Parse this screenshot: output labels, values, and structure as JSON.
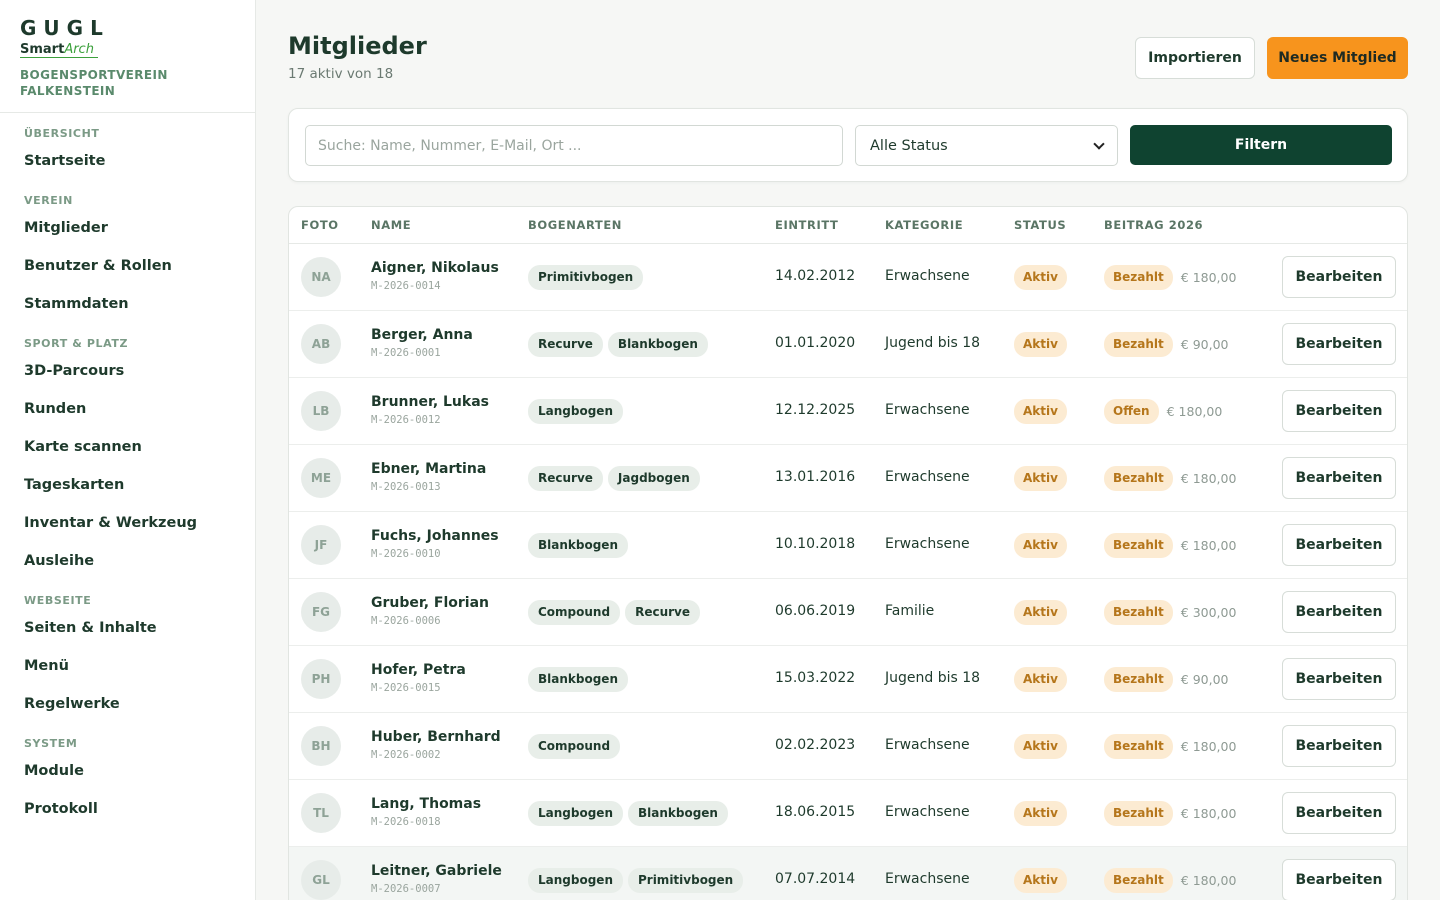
{
  "brand": {
    "logo_top": "GUGL",
    "logo_smart": "Smart",
    "logo_arch": "Arch",
    "club_line1": "BOGENSPORTVEREIN",
    "club_line2": "FALKENSTEIN"
  },
  "sidebar": {
    "sections": [
      {
        "title": "ÜBERSICHT",
        "items": [
          "Startseite"
        ]
      },
      {
        "title": "VEREIN",
        "items": [
          "Mitglieder",
          "Benutzer & Rollen",
          "Stammdaten"
        ]
      },
      {
        "title": "SPORT & PLATZ",
        "items": [
          "3D-Parcours",
          "Runden",
          "Karte scannen",
          "Tageskarten",
          "Inventar & Werkzeug",
          "Ausleihe"
        ]
      },
      {
        "title": "WEBSEITE",
        "items": [
          "Seiten & Inhalte",
          "Menü",
          "Regelwerke"
        ]
      },
      {
        "title": "SYSTEM",
        "items": [
          "Module",
          "Protokoll"
        ]
      }
    ]
  },
  "header": {
    "title": "Mitglieder",
    "subtitle": "17 aktiv von 18",
    "import_label": "Importieren",
    "new_label": "Neues Mitglied"
  },
  "filters": {
    "search_placeholder": "Suche: Name, Nummer, E-Mail, Ort ...",
    "status_value": "Alle Status",
    "filter_label": "Filtern"
  },
  "table": {
    "columns": [
      "FOTO",
      "NAME",
      "BOGENARTEN",
      "EINTRITT",
      "KATEGORIE",
      "STATUS",
      "BEITRAG 2026"
    ],
    "edit_label": "Bearbeiten",
    "rows": [
      {
        "initials": "NA",
        "name": "Aigner, Nikolaus",
        "number": "M-2026-0014",
        "bows": [
          "Primitivbogen"
        ],
        "joined": "14.02.2012",
        "category": "Erwachsene",
        "status": "Aktiv",
        "payment": "Bezahlt",
        "amount": "€ 180,00"
      },
      {
        "initials": "AB",
        "name": "Berger, Anna",
        "number": "M-2026-0001",
        "bows": [
          "Recurve",
          "Blankbogen"
        ],
        "joined": "01.01.2020",
        "category": "Jugend bis 18",
        "status": "Aktiv",
        "payment": "Bezahlt",
        "amount": "€ 90,00"
      },
      {
        "initials": "LB",
        "name": "Brunner, Lukas",
        "number": "M-2026-0012",
        "bows": [
          "Langbogen"
        ],
        "joined": "12.12.2025",
        "category": "Erwachsene",
        "status": "Aktiv",
        "payment": "Offen",
        "amount": "€ 180,00"
      },
      {
        "initials": "ME",
        "name": "Ebner, Martina",
        "number": "M-2026-0013",
        "bows": [
          "Recurve",
          "Jagdbogen"
        ],
        "joined": "13.01.2016",
        "category": "Erwachsene",
        "status": "Aktiv",
        "payment": "Bezahlt",
        "amount": "€ 180,00"
      },
      {
        "initials": "JF",
        "name": "Fuchs, Johannes",
        "number": "M-2026-0010",
        "bows": [
          "Blankbogen"
        ],
        "joined": "10.10.2018",
        "category": "Erwachsene",
        "status": "Aktiv",
        "payment": "Bezahlt",
        "amount": "€ 180,00"
      },
      {
        "initials": "FG",
        "name": "Gruber, Florian",
        "number": "M-2026-0006",
        "bows": [
          "Compound",
          "Recurve"
        ],
        "joined": "06.06.2019",
        "category": "Familie",
        "status": "Aktiv",
        "payment": "Bezahlt",
        "amount": "€ 300,00"
      },
      {
        "initials": "PH",
        "name": "Hofer, Petra",
        "number": "M-2026-0015",
        "bows": [
          "Blankbogen"
        ],
        "joined": "15.03.2022",
        "category": "Jugend bis 18",
        "status": "Aktiv",
        "payment": "Bezahlt",
        "amount": "€ 90,00"
      },
      {
        "initials": "BH",
        "name": "Huber, Bernhard",
        "number": "M-2026-0002",
        "bows": [
          "Compound"
        ],
        "joined": "02.02.2023",
        "category": "Erwachsene",
        "status": "Aktiv",
        "payment": "Bezahlt",
        "amount": "€ 180,00"
      },
      {
        "initials": "TL",
        "name": "Lang, Thomas",
        "number": "M-2026-0018",
        "bows": [
          "Langbogen",
          "Blankbogen"
        ],
        "joined": "18.06.2015",
        "category": "Erwachsene",
        "status": "Aktiv",
        "payment": "Bezahlt",
        "amount": "€ 180,00"
      },
      {
        "initials": "GL",
        "name": "Leitner, Gabriele",
        "number": "M-2026-0007",
        "bows": [
          "Langbogen",
          "Primitivbogen"
        ],
        "joined": "07.07.2014",
        "category": "Erwachsene",
        "status": "Aktiv",
        "payment": "Bezahlt",
        "amount": "€ 180,00"
      }
    ]
  },
  "colors": {
    "primary_dark": "#0f4330",
    "accent_orange": "#f7941d",
    "badge_bg": "#fcebd2",
    "badge_text": "#b5761b",
    "chip_bg": "#e8eee9"
  }
}
